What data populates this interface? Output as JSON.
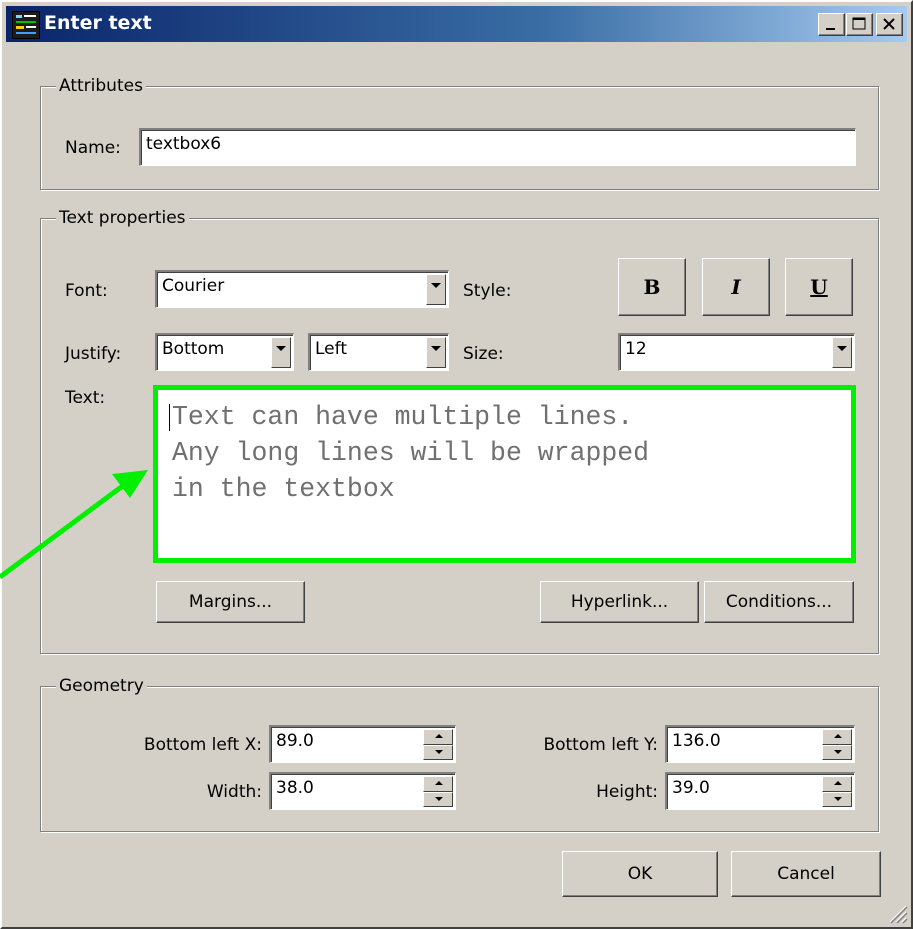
{
  "window": {
    "title": "Enter text",
    "app_icon": "geda-app-icon",
    "controls": [
      "minimize-icon",
      "maximize-icon",
      "close-icon"
    ]
  },
  "attributes": {
    "group_label": "Attributes",
    "name_label": "Name:",
    "name_value": "textbox6"
  },
  "text_properties": {
    "group_label": "Text properties",
    "font_label": "Font:",
    "font_value": "Courier",
    "style_label": "Style:",
    "bold_label": "B",
    "italic_label": "I",
    "underline_label": "U",
    "justify_label": "Justify:",
    "justify_vertical": "Bottom",
    "justify_horizontal": "Left",
    "size_label": "Size:",
    "size_value": "12",
    "text_label": "Text:",
    "text_value": "Text can have multiple lines.\nAny long lines will be wrapped\nin the textbox",
    "margins_button": "Margins...",
    "hyperlink_button": "Hyperlink...",
    "conditions_button": "Conditions..."
  },
  "geometry": {
    "group_label": "Geometry",
    "bottom_left_x_label": "Bottom left X:",
    "bottom_left_x_value": "89.0",
    "bottom_left_y_label": "Bottom left Y:",
    "bottom_left_y_value": "136.0",
    "width_label": "Width:",
    "width_value": "38.0",
    "height_label": "Height:",
    "height_value": "39.0"
  },
  "footer": {
    "ok_button": "OK",
    "cancel_button": "Cancel"
  },
  "colors": {
    "highlight": "#00f000",
    "titlebar_start": "#0a246a",
    "titlebar_end": "#a6caf0",
    "face": "#d4d0c8"
  }
}
